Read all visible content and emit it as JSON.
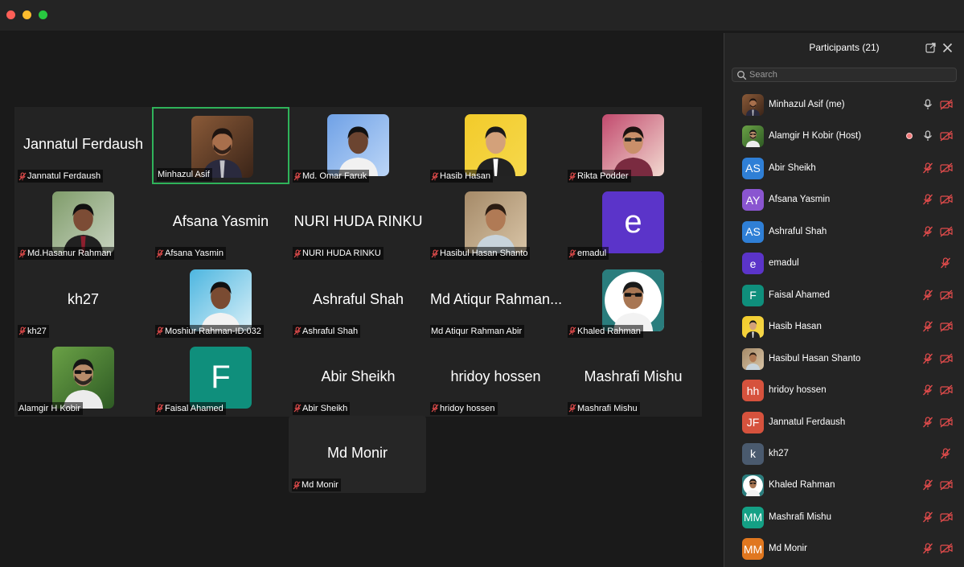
{
  "window": {
    "traffic_lights": [
      "close",
      "minimize",
      "zoom"
    ]
  },
  "gallery": {
    "tiles": [
      {
        "big_name": "Jannatul Ferdaush",
        "label": "Jannatul Ferdaush",
        "muted": true,
        "media": "name"
      },
      {
        "big_name": "",
        "label": "Minhazul Asif",
        "muted": false,
        "media": "photo",
        "photo": "man-suit-beard",
        "active": true
      },
      {
        "big_name": "",
        "label": "Md. Omar Faruk",
        "muted": true,
        "media": "photo",
        "photo": "man-shirt-blue-bg"
      },
      {
        "big_name": "",
        "label": "Hasib Hasan",
        "muted": true,
        "media": "photo",
        "photo": "man-suit-yellow-bg"
      },
      {
        "big_name": "",
        "label": "Rikta Podder",
        "muted": true,
        "media": "photo",
        "photo": "woman-glasses"
      },
      {
        "big_name": "",
        "label": "Md.Hasanur Rahman",
        "muted": true,
        "media": "photo",
        "photo": "man-suit-outdoor"
      },
      {
        "big_name": "Afsana Yasmin",
        "label": "Afsana Yasmin",
        "muted": true,
        "media": "name"
      },
      {
        "big_name": "NURI HUDA RINKU",
        "label": "NURI HUDA RINKU",
        "muted": true,
        "media": "name"
      },
      {
        "big_name": "",
        "label": "Hasibul Hasan Shanto",
        "muted": true,
        "media": "photo",
        "photo": "man-casual-outdoor"
      },
      {
        "big_name": "",
        "label": "emadul",
        "muted": true,
        "media": "letter",
        "letter": "e",
        "color": "#5b34c9"
      },
      {
        "big_name": "kh27",
        "label": "kh27",
        "muted": true,
        "media": "name"
      },
      {
        "big_name": "",
        "label": "Moshiur Rahman-ID:032",
        "muted": true,
        "media": "photo",
        "photo": "man-beach"
      },
      {
        "big_name": "Ashraful Shah",
        "label": "Ashraful Shah",
        "muted": true,
        "media": "name"
      },
      {
        "big_name": "Md Atiqur Rahman...",
        "label": "Md Atiqur Rahman Abir",
        "muted": false,
        "media": "name"
      },
      {
        "big_name": "",
        "label": "Khaled Rahman",
        "muted": true,
        "media": "photo",
        "photo": "man-sunglasses-round"
      },
      {
        "big_name": "",
        "label": "Alamgir H Kobir",
        "muted": false,
        "media": "photo",
        "photo": "man-beard-sunglasses"
      },
      {
        "big_name": "",
        "label": "Faisal Ahamed",
        "muted": true,
        "media": "letter",
        "letter": "F",
        "color": "#0f8f7c"
      },
      {
        "big_name": "Abir Sheikh",
        "label": "Abir Sheikh",
        "muted": true,
        "media": "name"
      },
      {
        "big_name": "hridoy hossen",
        "label": "hridoy hossen",
        "muted": true,
        "media": "name"
      },
      {
        "big_name": "Mashrafi Mishu",
        "label": "Mashrafi Mishu",
        "muted": true,
        "media": "name"
      },
      {
        "big_name": "Md Monir",
        "label": "Md Monir",
        "muted": true,
        "media": "name",
        "last": true
      }
    ]
  },
  "participants_panel": {
    "title": "Participants (21)",
    "search_placeholder": "Search",
    "participants": [
      {
        "name": "Minhazul Asif (me)",
        "avatar": "photo",
        "photo": "man-suit-beard",
        "mic": "on",
        "video": "off"
      },
      {
        "name": "Alamgir H Kobir (Host)",
        "avatar": "photo",
        "photo": "man-beard-sunglasses",
        "mic": "on",
        "video": "off",
        "recording": true
      },
      {
        "name": "Abir Sheikh",
        "avatar": "AS",
        "color": "#2f7fd6",
        "mic": "muted",
        "video": "off"
      },
      {
        "name": "Afsana Yasmin",
        "avatar": "AY",
        "color": "#8a55d0",
        "mic": "muted",
        "video": "off"
      },
      {
        "name": "Ashraful Shah",
        "avatar": "AS",
        "color": "#2f7fd6",
        "mic": "muted",
        "video": "off"
      },
      {
        "name": "emadul",
        "avatar": "e",
        "color": "#5b34c9",
        "mic": "muted",
        "video": "none"
      },
      {
        "name": "Faisal Ahamed",
        "avatar": "F",
        "color": "#0f8f7c",
        "mic": "muted",
        "video": "off"
      },
      {
        "name": "Hasib Hasan",
        "avatar": "photo",
        "photo": "man-suit-yellow-bg",
        "mic": "muted",
        "video": "off"
      },
      {
        "name": "Hasibul Hasan Shanto",
        "avatar": "photo",
        "photo": "man-casual-outdoor",
        "mic": "muted",
        "video": "off"
      },
      {
        "name": "hridoy hossen",
        "avatar": "hh",
        "color": "#d6523d",
        "mic": "muted",
        "video": "off"
      },
      {
        "name": "Jannatul Ferdaush",
        "avatar": "JF",
        "color": "#d6523d",
        "mic": "muted",
        "video": "off"
      },
      {
        "name": "kh27",
        "avatar": "k",
        "color": "#4a5a6e",
        "mic": "muted",
        "video": "none"
      },
      {
        "name": "Khaled Rahman",
        "avatar": "photo",
        "photo": "man-sunglasses-round",
        "mic": "muted",
        "video": "off"
      },
      {
        "name": "Mashrafi Mishu",
        "avatar": "MM",
        "color": "#14a085",
        "mic": "muted",
        "video": "off"
      },
      {
        "name": "Md Monir",
        "avatar": "MM",
        "color": "#e0771f",
        "mic": "muted",
        "video": "off"
      }
    ]
  }
}
